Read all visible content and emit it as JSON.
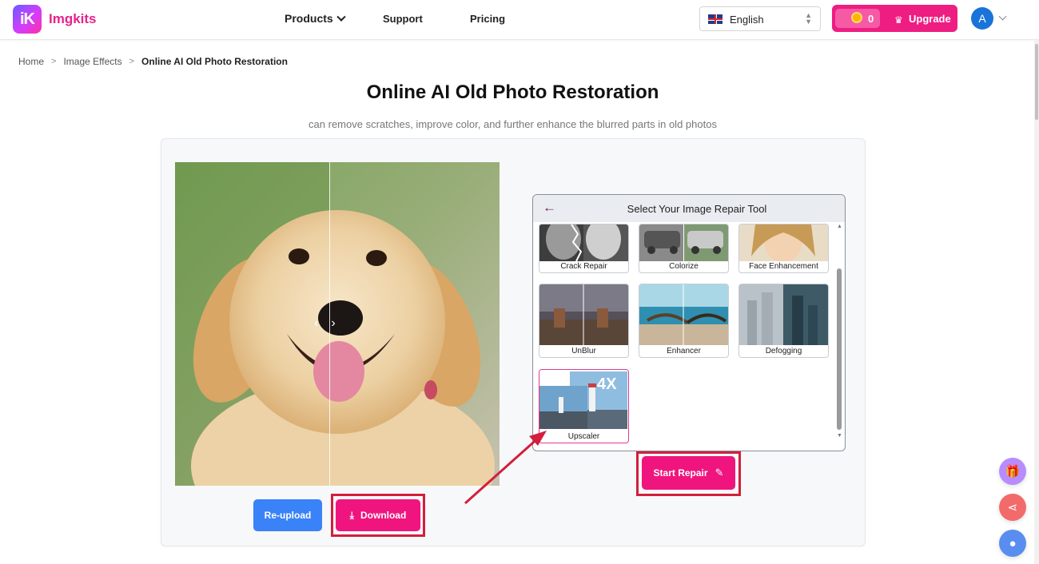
{
  "header": {
    "logo_text": "iK",
    "brand": "Imgkits",
    "nav": [
      {
        "label": "Products",
        "icon": "chevron-down-icon"
      },
      {
        "label": "Support"
      },
      {
        "label": "Pricing"
      }
    ],
    "language": {
      "selected": "English",
      "flag": "uk-flag-icon"
    },
    "credits": "0",
    "upgrade_label": "Upgrade",
    "avatar_initial": "A"
  },
  "breadcrumb": [
    "Home",
    "Image Effects",
    "Online AI Old Photo Restoration"
  ],
  "page": {
    "title": "Online AI Old Photo Restoration",
    "subtitle": "can remove scratches, improve color, and further enhance the blurred parts in old photos"
  },
  "preview": {
    "reupload_label": "Re-upload",
    "download_label": "Download"
  },
  "tools": {
    "title": "Select Your Image Repair Tool",
    "items": [
      {
        "label": "Crack Repair"
      },
      {
        "label": "Colorize"
      },
      {
        "label": "Face Enhancement"
      },
      {
        "label": "UnBlur"
      },
      {
        "label": "Enhancer"
      },
      {
        "label": "Defogging"
      },
      {
        "label": "Upscaler",
        "badge": "4X",
        "selected": true
      }
    ],
    "start_label": "Start Repair"
  },
  "colors": {
    "accent": "#ee1d82",
    "brand": "#e6238a",
    "reupload": "#3a82f7",
    "highlight_frame": "#d21f3c"
  }
}
